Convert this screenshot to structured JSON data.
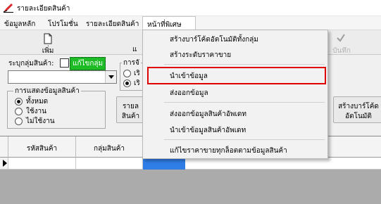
{
  "window": {
    "title": "รายละเอียดสินค้า"
  },
  "menubar": {
    "items": [
      "ข้อมูลหลัก",
      "โปรโมชั่น",
      "รายละเอียดสินค้า",
      "หน้าที่พิเศษ"
    ]
  },
  "toolbar": {
    "add_label": "เพิ่ม",
    "second_fragment": "แ",
    "save_label": "บันทึก"
  },
  "filter": {
    "group_label": "ระบุกลุ่มสินค้า:",
    "edit_group_label": "แก้ไขกลุ่ม",
    "group_combo_value": ""
  },
  "display_group": {
    "legend": "การแสดงข้อมูลสินค้า",
    "options": [
      "ทั้งหมด",
      "ใช้งาน",
      "ไม่ใช้งาน"
    ],
    "selected": 0
  },
  "second_group": {
    "legend": "การจั",
    "options": [
      "เริ",
      "เริ"
    ],
    "selected": 1
  },
  "buttons": {
    "report_line1": "รายล",
    "report_line2": "สินค้า",
    "barcode_auto_line1": "สร้างบาร์โค้ด",
    "barcode_auto_line2": "อัตโนมัติ"
  },
  "grid": {
    "columns": [
      "รหัสสินค้า",
      "กลุ่มสินค้า"
    ]
  },
  "dropdown": {
    "items": [
      "สร้างบาร์โค้ดอัตโนมัติทั้งกลุ่ม",
      "สร้างระดับราคาขาย",
      "นำเข้าข้อมูล",
      "ส่งออกข้อมูล",
      "ส่งออกข้อมูลสินค้าอัพเดท",
      "นำเข้าข้อมูลสินค้าอัพเดท",
      "แก้ไขราคาขายทุกล็อตตามข้อมูลสินค้า"
    ],
    "highlighted_index": 2
  },
  "colors": {
    "highlight_border": "#e00000",
    "edit_group_bg": "#1dbb25",
    "selected_cell": "#2f7de6"
  },
  "icons": [
    "app-edit-icon",
    "new-document-icon",
    "checkmark-icon",
    "dropdown-arrow-icon",
    "row-pointer-icon"
  ]
}
